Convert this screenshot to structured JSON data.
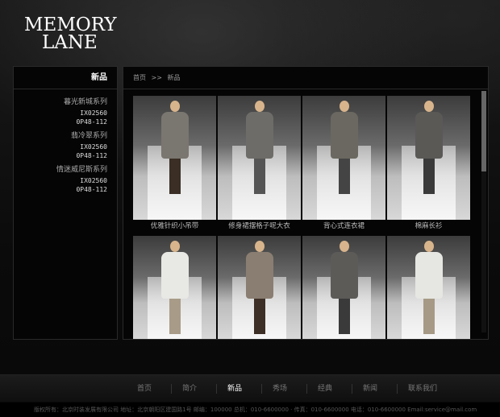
{
  "logo": {
    "line1": "MEMORY",
    "line2": "LANE"
  },
  "sidebar": {
    "title": "新品",
    "categories": [
      {
        "name": "暮光新城系列",
        "codes": [
          "IX02560",
          "0P48-112"
        ]
      },
      {
        "name": "翡冷翠系列",
        "codes": [
          "IX02560",
          "0P48-112"
        ]
      },
      {
        "name": "情迷威尼斯系列",
        "codes": [
          "IX02560",
          "0P48-112"
        ]
      }
    ]
  },
  "breadcrumb": {
    "home": "首页",
    "separator": ">>",
    "current": "新品"
  },
  "products": [
    {
      "caption": "优雅针织小吊带",
      "top": "#7a7670",
      "bottom": "#3a2e25"
    },
    {
      "caption": "修身裙摆格子呢大衣",
      "top": "#6e6c68",
      "bottom": "#555"
    },
    {
      "caption": "背心式连衣裙",
      "top": "#6a6860",
      "bottom": "#444"
    },
    {
      "caption": "棉麻长衫",
      "top": "#5a5956",
      "bottom": "#3a3a3a"
    },
    {
      "caption": "",
      "top": "#e8e8e4",
      "bottom": "#a89c88"
    },
    {
      "caption": "",
      "top": "#8a7e72",
      "bottom": "#3d2f25"
    },
    {
      "caption": "",
      "top": "#5c5b58",
      "bottom": "#3a3a3a"
    },
    {
      "caption": "",
      "top": "#e6e6e2",
      "bottom": "#a69a86"
    }
  ],
  "footer": {
    "nav": [
      "首页",
      "简介",
      "新品",
      "秀场",
      "经典",
      "新闻",
      "联系我们"
    ],
    "active": "新品",
    "copyright": "版权所有：北京时装发展有限公司 地址：北京朝阳区建国路1号 邮编：100000 总机：010-6600000 · 传真：010-6600000 电话：010-6600000 Email:service@mail.com"
  },
  "colors": {
    "background": "#0c0c0c",
    "border": "#2a2a2a",
    "active_text": "#ffffff"
  }
}
